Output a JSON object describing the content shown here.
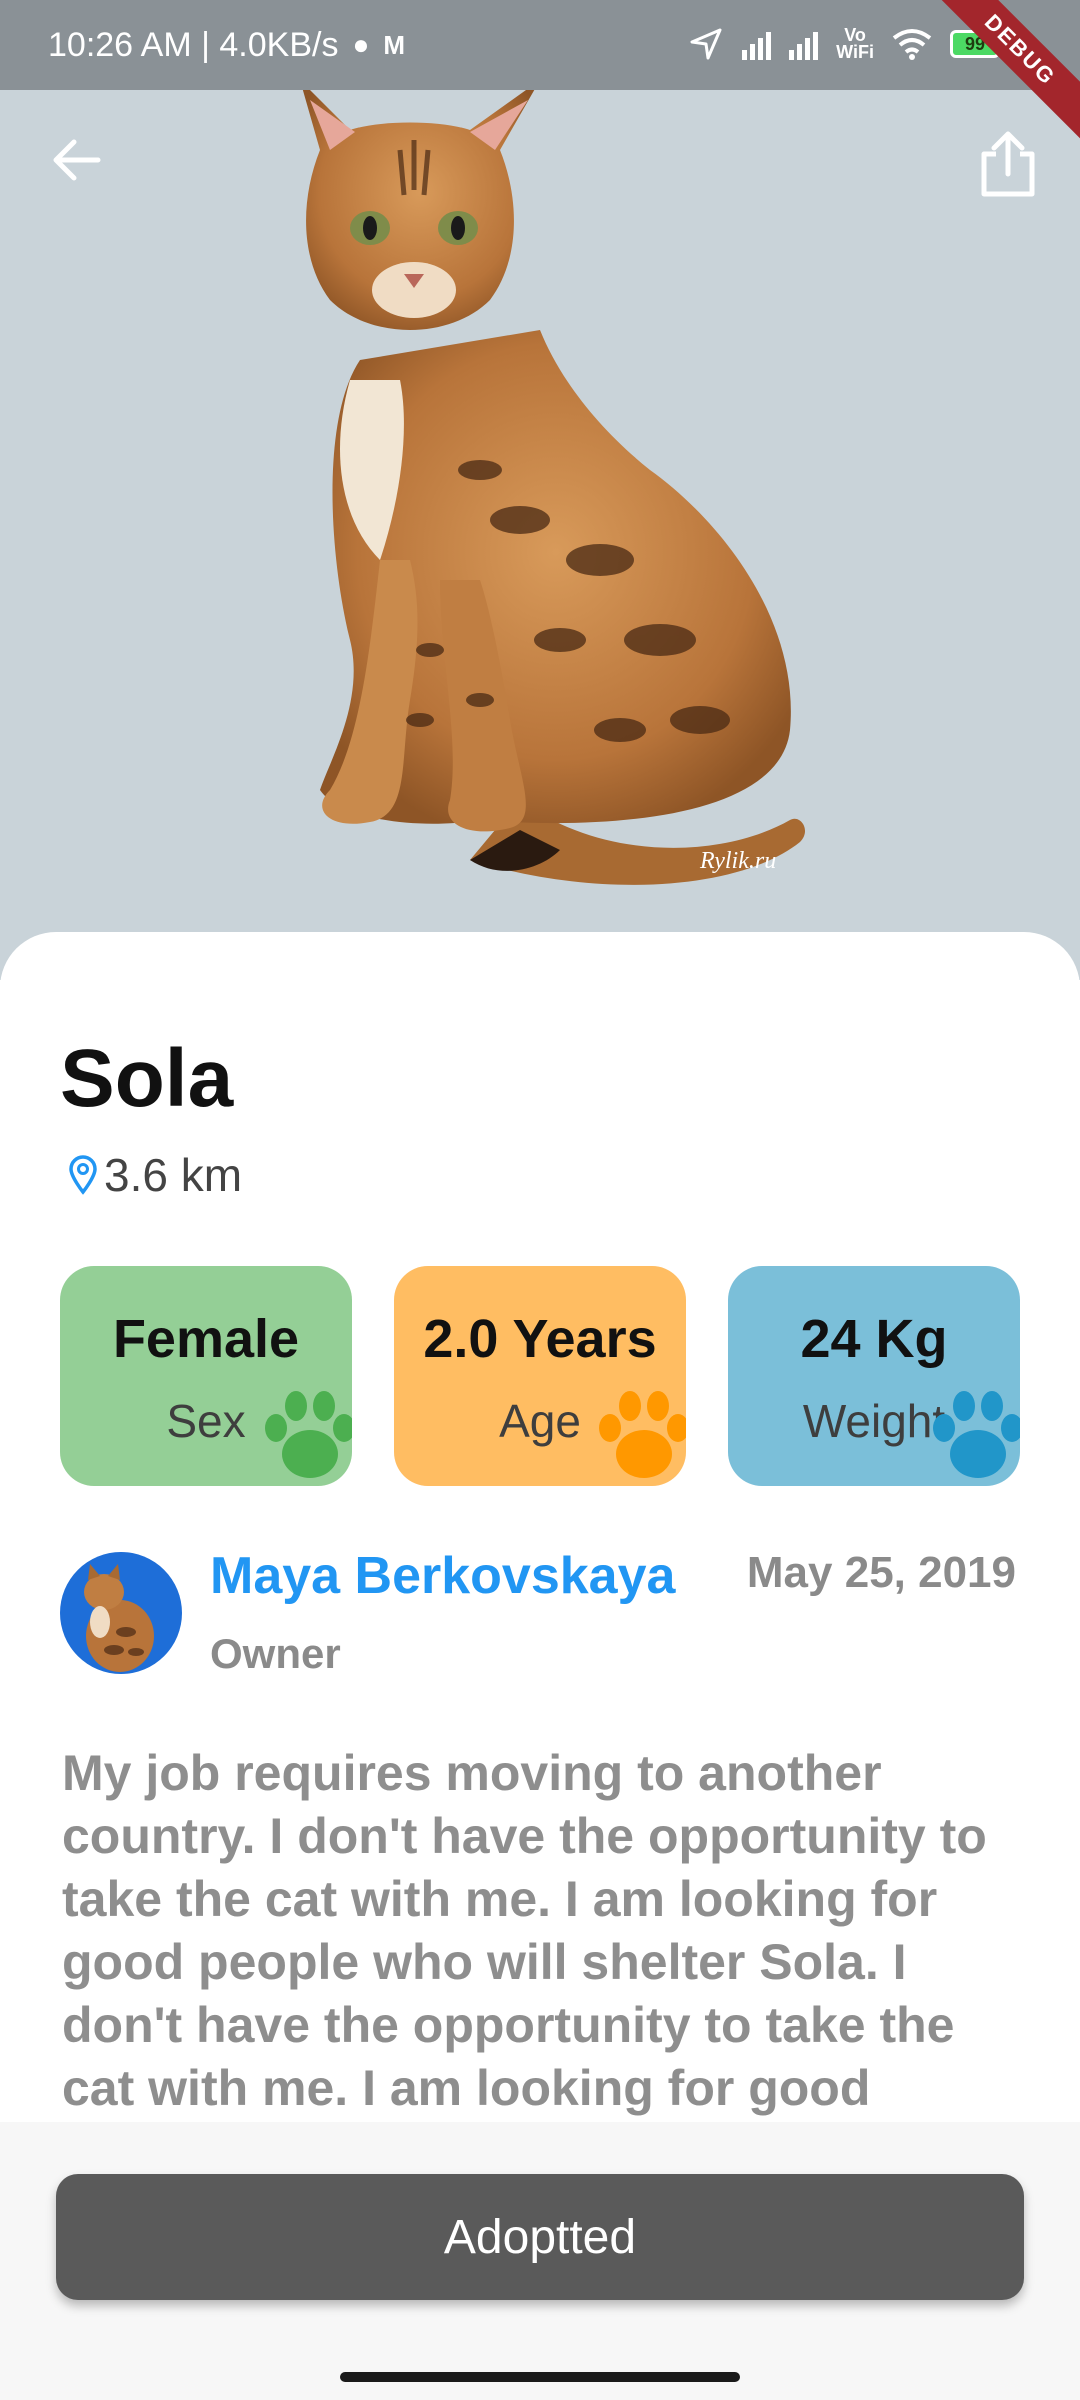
{
  "status_bar": {
    "time_text": "10:26 AM | 4.0KB/s",
    "vowifi_line1": "Vo",
    "vowifi_line2": "WiFi",
    "battery": "99",
    "debug_label": "DEBUG"
  },
  "pet": {
    "name": "Sola",
    "distance": "3.6 km",
    "image_watermark": "Rylik.ru"
  },
  "stats": [
    {
      "value": "Female",
      "label": "Sex",
      "color": "#94cf96",
      "paw_color": "#4caf50"
    },
    {
      "value": "2.0 Years",
      "label": "Age",
      "color": "#ffbd62",
      "paw_color": "#ff9800"
    },
    {
      "value": "24 Kg",
      "label": "Weight",
      "color": "#7bbfd9",
      "paw_color": "#2196c9"
    }
  ],
  "owner": {
    "name": "Maya Berkovskaya",
    "role": "Owner",
    "date": "May 25, 2019"
  },
  "description": "My job requires moving to another country. I don't have the opportunity to take the cat with me. I am looking for good people who will shelter Sola.  I don't have the opportunity to take the cat with me. I am looking for good people who will shelter Sola.",
  "actions": {
    "adopt_label": "Adoptted"
  },
  "colors": {
    "accent": "#2196f3",
    "hero_bg": "#c9d3d9",
    "button_bg": "#5a5a5a"
  }
}
